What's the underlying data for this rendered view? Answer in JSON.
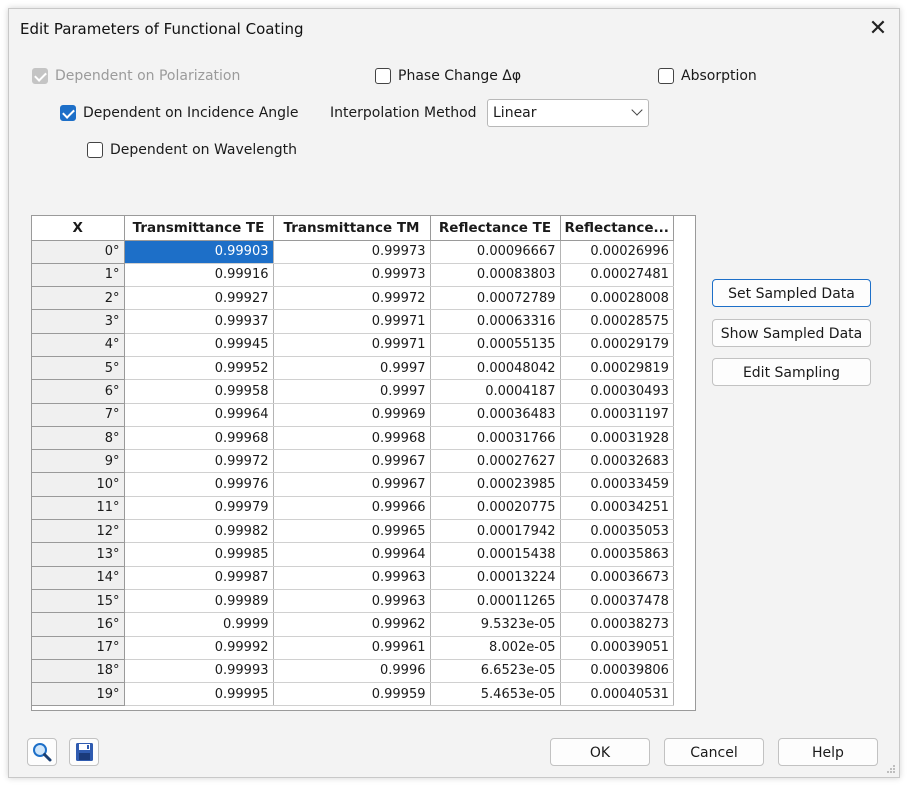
{
  "window": {
    "title": "Edit Parameters of Functional Coating",
    "close_label": "✕"
  },
  "options": {
    "dep_polarization": {
      "label": "Dependent on Polarization",
      "checked": true,
      "disabled": true
    },
    "phase_change": {
      "label": "Phase Change Δφ",
      "checked": false
    },
    "absorption": {
      "label": "Absorption",
      "checked": false
    },
    "dep_incidence": {
      "label": "Dependent on Incidence Angle",
      "checked": true
    },
    "dep_wavelength": {
      "label": "Dependent on Wavelength",
      "checked": false
    },
    "interp_label": "Interpolation Method",
    "interp_value": "Linear"
  },
  "table": {
    "headers": [
      "X",
      "Transmittance TE",
      "Transmittance TM",
      "Reflectance TE",
      "Reflectance..."
    ],
    "rows": [
      [
        "0°",
        "0.99903",
        "0.99973",
        "0.00096667",
        "0.00026996"
      ],
      [
        "1°",
        "0.99916",
        "0.99973",
        "0.00083803",
        "0.00027481"
      ],
      [
        "2°",
        "0.99927",
        "0.99972",
        "0.00072789",
        "0.00028008"
      ],
      [
        "3°",
        "0.99937",
        "0.99971",
        "0.00063316",
        "0.00028575"
      ],
      [
        "4°",
        "0.99945",
        "0.99971",
        "0.00055135",
        "0.00029179"
      ],
      [
        "5°",
        "0.99952",
        "0.9997",
        "0.00048042",
        "0.00029819"
      ],
      [
        "6°",
        "0.99958",
        "0.9997",
        "0.0004187",
        "0.00030493"
      ],
      [
        "7°",
        "0.99964",
        "0.99969",
        "0.00036483",
        "0.00031197"
      ],
      [
        "8°",
        "0.99968",
        "0.99968",
        "0.00031766",
        "0.00031928"
      ],
      [
        "9°",
        "0.99972",
        "0.99967",
        "0.00027627",
        "0.00032683"
      ],
      [
        "10°",
        "0.99976",
        "0.99967",
        "0.00023985",
        "0.00033459"
      ],
      [
        "11°",
        "0.99979",
        "0.99966",
        "0.00020775",
        "0.00034251"
      ],
      [
        "12°",
        "0.99982",
        "0.99965",
        "0.00017942",
        "0.00035053"
      ],
      [
        "13°",
        "0.99985",
        "0.99964",
        "0.00015438",
        "0.00035863"
      ],
      [
        "14°",
        "0.99987",
        "0.99963",
        "0.00013224",
        "0.00036673"
      ],
      [
        "15°",
        "0.99989",
        "0.99963",
        "0.00011265",
        "0.00037478"
      ],
      [
        "16°",
        "0.9999",
        "0.99962",
        "9.5323e-05",
        "0.00038273"
      ],
      [
        "17°",
        "0.99992",
        "0.99961",
        "8.002e-05",
        "0.00039051"
      ],
      [
        "18°",
        "0.99993",
        "0.9996",
        "6.6523e-05",
        "0.00039806"
      ],
      [
        "19°",
        "0.99995",
        "0.99959",
        "5.4653e-05",
        "0.00040531"
      ]
    ]
  },
  "side_buttons": {
    "set_sampled": "Set Sampled Data",
    "show_sampled": "Show Sampled Data",
    "edit_sampling": "Edit Sampling"
  },
  "footer": {
    "ok": "OK",
    "cancel": "Cancel",
    "help": "Help"
  },
  "icons": {
    "search": "magnifier-icon",
    "save": "floppy-disk-icon"
  },
  "colors": {
    "accent": "#1d6fc8",
    "disabled": "#c4c4c4"
  }
}
